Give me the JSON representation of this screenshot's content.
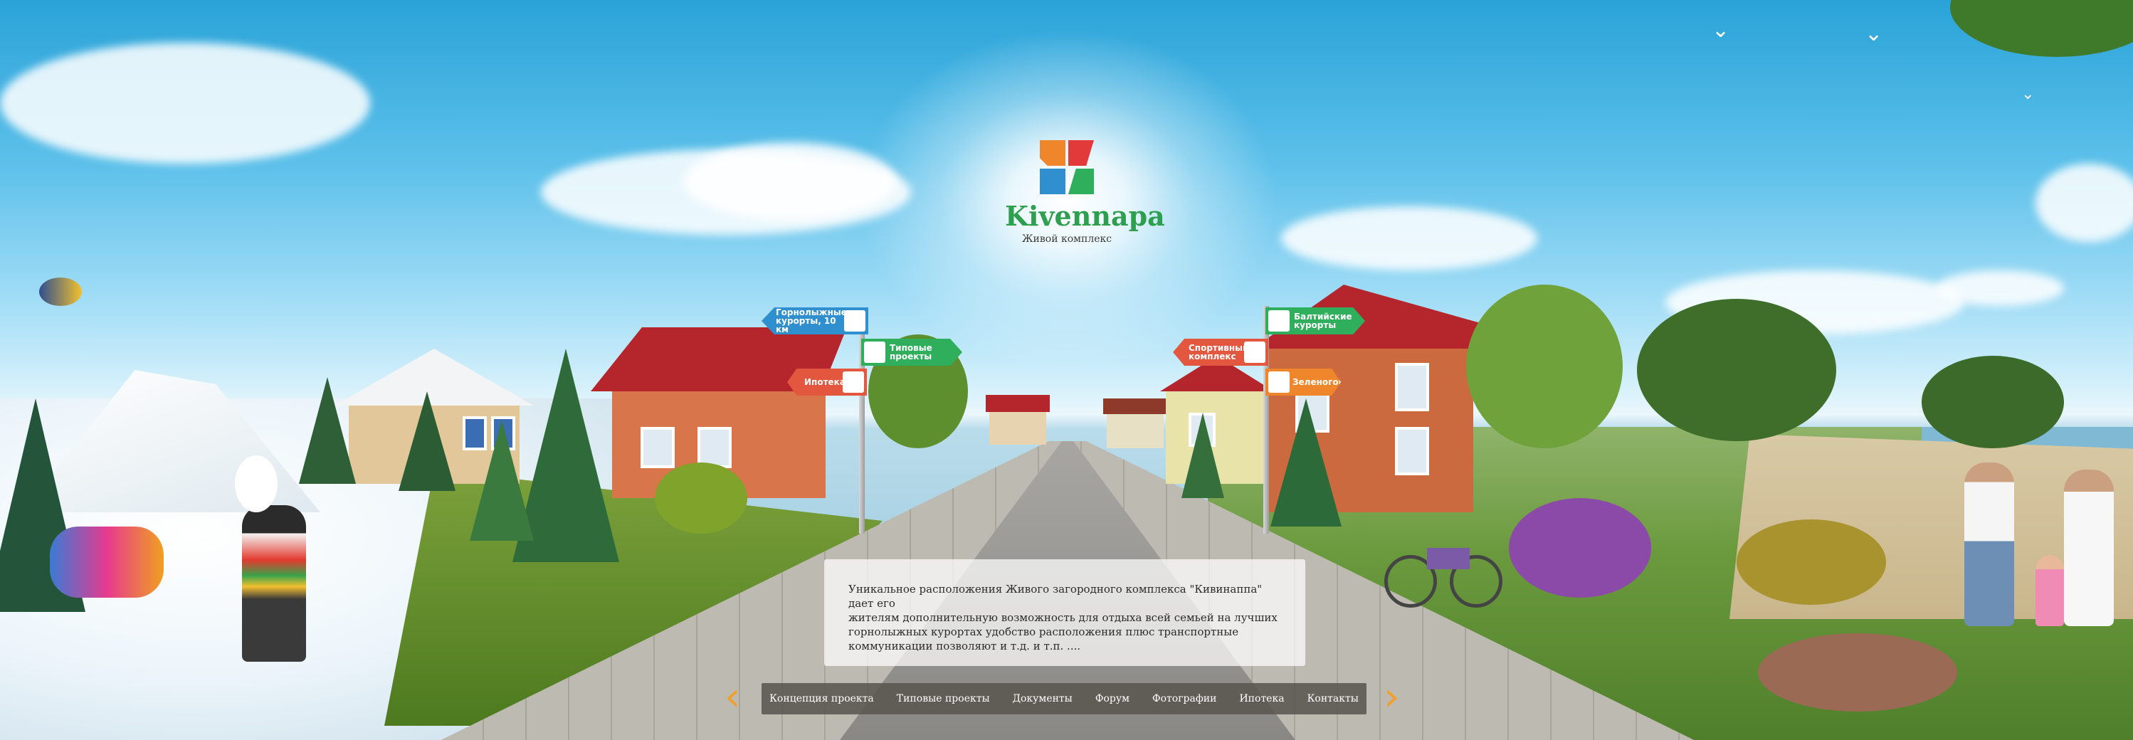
{
  "brand": {
    "name": "Kivennapa",
    "tagline": "Живой комплекс"
  },
  "signs": [
    {
      "label": "Горнолыжные курорты, 10 км",
      "color": "#2f8fcf"
    },
    {
      "label": "Типовые проекты",
      "color": "#2fae5b"
    },
    {
      "label": "Ипотека",
      "color": "#e4573f"
    },
    {
      "label": "Спортивный комплекс",
      "color": "#e4573f"
    },
    {
      "label": "Балтийские курорты",
      "color": "#2fae5b"
    },
    {
      "label": "Зеленогорск",
      "color": "#f0862c"
    }
  ],
  "info": {
    "text_line1": "Уникальное расположения Живого загородного комплекса \"Кивинаппа\" дает его",
    "text_line2": "жителям дополнительную возможность для отдыха всей семьей на лучших",
    "text_line3": "горнолыжных курортах удобство расположения плюс транспортные",
    "text_line4": "коммуникации позволяют  и т.д.  и т.п.  ...."
  },
  "nav": {
    "prev_icon": "chevron-left-icon",
    "next_icon": "chevron-right-icon",
    "items": [
      {
        "label": "Концепция проекта"
      },
      {
        "label": "Типовые проекты"
      },
      {
        "label": "Документы"
      },
      {
        "label": "Форум"
      },
      {
        "label": "Фотографии"
      },
      {
        "label": "Ипотека"
      },
      {
        "label": "Контакты"
      }
    ]
  },
  "colors": {
    "accent_green": "#2e9e4f",
    "nav_arrow": "#f0a02c",
    "nav_bg": "#5a5650"
  }
}
